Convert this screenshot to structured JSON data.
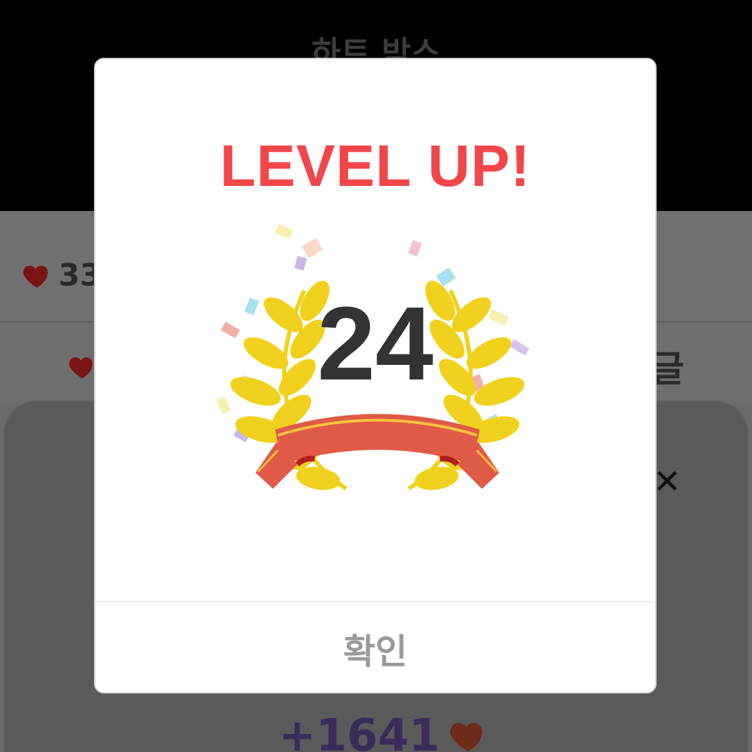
{
  "background": {
    "header_title": "하트 박스",
    "heart_count": "33",
    "tab_label_partial": "글",
    "reward_text": "+1641"
  },
  "modal": {
    "title": "LEVEL UP!",
    "level": "24",
    "confirm_label": "확인"
  },
  "colors": {
    "title_red": "#f2474a",
    "laurel_yellow": "#f0d21e",
    "ribbon_red": "#e05a48",
    "heart_red": "#c62828"
  },
  "icons": {
    "heart": "heart-icon",
    "close": "close-icon",
    "laurel": "laurel-wreath-icon"
  }
}
